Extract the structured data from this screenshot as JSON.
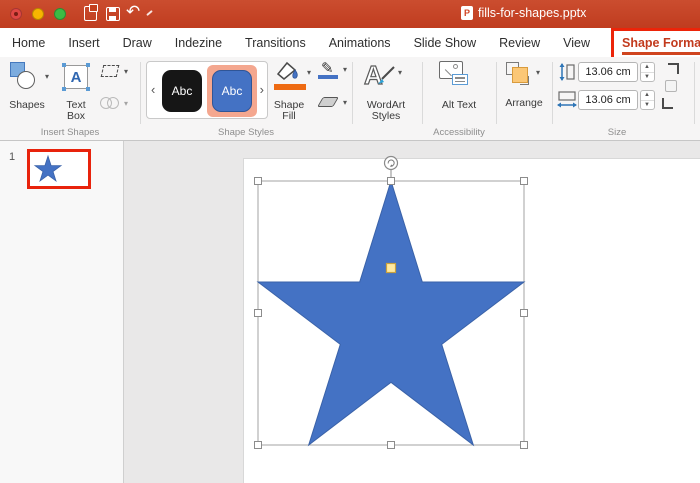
{
  "window": {
    "title": "fills-for-shapes.pptx"
  },
  "icons": {
    "chevron_down": "▾",
    "gallery_prev": "‹",
    "gallery_next": "›",
    "undo": "↶",
    "pencil": "✎",
    "text_box_letter": "A",
    "wordart_letter": "A",
    "ppt_letter": "P"
  },
  "tabs": {
    "items": [
      "Home",
      "Insert",
      "Draw",
      "Indezine",
      "Transitions",
      "Animations",
      "Slide Show",
      "Review",
      "View",
      "Shape Format"
    ],
    "active": "Shape Format"
  },
  "ribbon": {
    "insert_shapes": {
      "shapes_label": "Shapes",
      "text_box_label": "Text Box",
      "group_label": "Insert Shapes"
    },
    "shape_styles": {
      "styles": [
        "Abc",
        "Abc"
      ],
      "selected_index": 1,
      "shape_fill_label": "Shape Fill",
      "group_label": "Shape Styles"
    },
    "wordart": {
      "label": "WordArt Styles"
    },
    "accessibility": {
      "alt_text_label": "Alt Text",
      "group_label": "Accessibility"
    },
    "arrange": {
      "label": "Arrange"
    },
    "size": {
      "height": "13.06 cm",
      "width": "13.06 cm",
      "group_label": "Size"
    }
  },
  "slide_panel": {
    "slide_number": "1"
  },
  "colors": {
    "titlebar_red": "#C5452B",
    "annotation_red": "#E8230C",
    "accent_blue": "#4472C4",
    "fill_orange": "#EE6A12",
    "selected_style_highlight": "#F4A78F",
    "adjust_handle_yellow": "#FFE9A0"
  }
}
